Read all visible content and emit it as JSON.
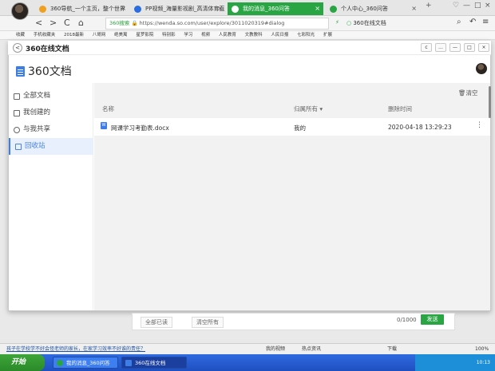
{
  "browser": {
    "tabs": [
      {
        "label": "360导航_一个主页，整个世界",
        "icon_color": "#f0a020",
        "active": false
      },
      {
        "label": "PP视频_海量影视剧_高清体育直",
        "icon_color": "#2a6de0",
        "active": false
      },
      {
        "label": "我的消息_360问答",
        "icon_color": "#ffffff",
        "active": true
      },
      {
        "label": "个人中心_360问答",
        "icon_color": "#29a544",
        "active": false
      }
    ],
    "tab_close": "×",
    "new_tab": "+",
    "window_controls": [
      "♡",
      "—",
      "□",
      "×"
    ],
    "nav": {
      "back": "<",
      "forward": ">",
      "reload": "C",
      "home": "⌂"
    },
    "url_prefix": "360搜索",
    "url": "https://wenda.so.com/user/explore/3011020319#dialog",
    "search_text": "360在线文档",
    "bookmarks": [
      "收藏",
      "手机收藏夹",
      "2018最新",
      "八哥网",
      "绝美寓",
      "星罗影院",
      "特别影",
      "学习",
      "视频",
      "人民教育",
      "文教教科",
      "人民日报",
      "七彩阳光",
      "扩展"
    ],
    "accent": "#29a544"
  },
  "modal": {
    "back_label": "<",
    "title": "360在线文档",
    "controls": [
      "c",
      "...",
      "—",
      "□",
      "×"
    ],
    "logo_text": "360文档",
    "sidebar": [
      {
        "label": "全部文档",
        "active": false
      },
      {
        "label": "我创建的",
        "active": false
      },
      {
        "label": "与我共享",
        "active": false
      },
      {
        "label": "回收站",
        "active": true
      }
    ],
    "clear_label": "清空",
    "columns": {
      "name": "名称",
      "owner": "归属所有 ▾",
      "deleted": "删除时间"
    },
    "rows": [
      {
        "file_icon": "W",
        "name": "网课学习考勤表.docx",
        "owner": "我的",
        "deleted": "2020-04-18 13:29:23",
        "more": "⋮"
      }
    ],
    "accent": "#3d7ee6"
  },
  "lower_panel": {
    "read_all": "全部已读",
    "clear_all": "清空所有",
    "counter": "0/1000",
    "send": "发送"
  },
  "status_bar": {
    "link": "孩子在学校学不好会怪老师的家长，在家学习效率不好谁的责任？",
    "items": [
      "我的视频",
      "热点资讯",
      "下载",
      "100%"
    ]
  },
  "taskbar": {
    "start": "开始",
    "tasks": [
      {
        "label": "我的消息_360问答",
        "active": false
      },
      {
        "label": "360在线文档",
        "active": true
      }
    ],
    "clock": "10:13"
  }
}
